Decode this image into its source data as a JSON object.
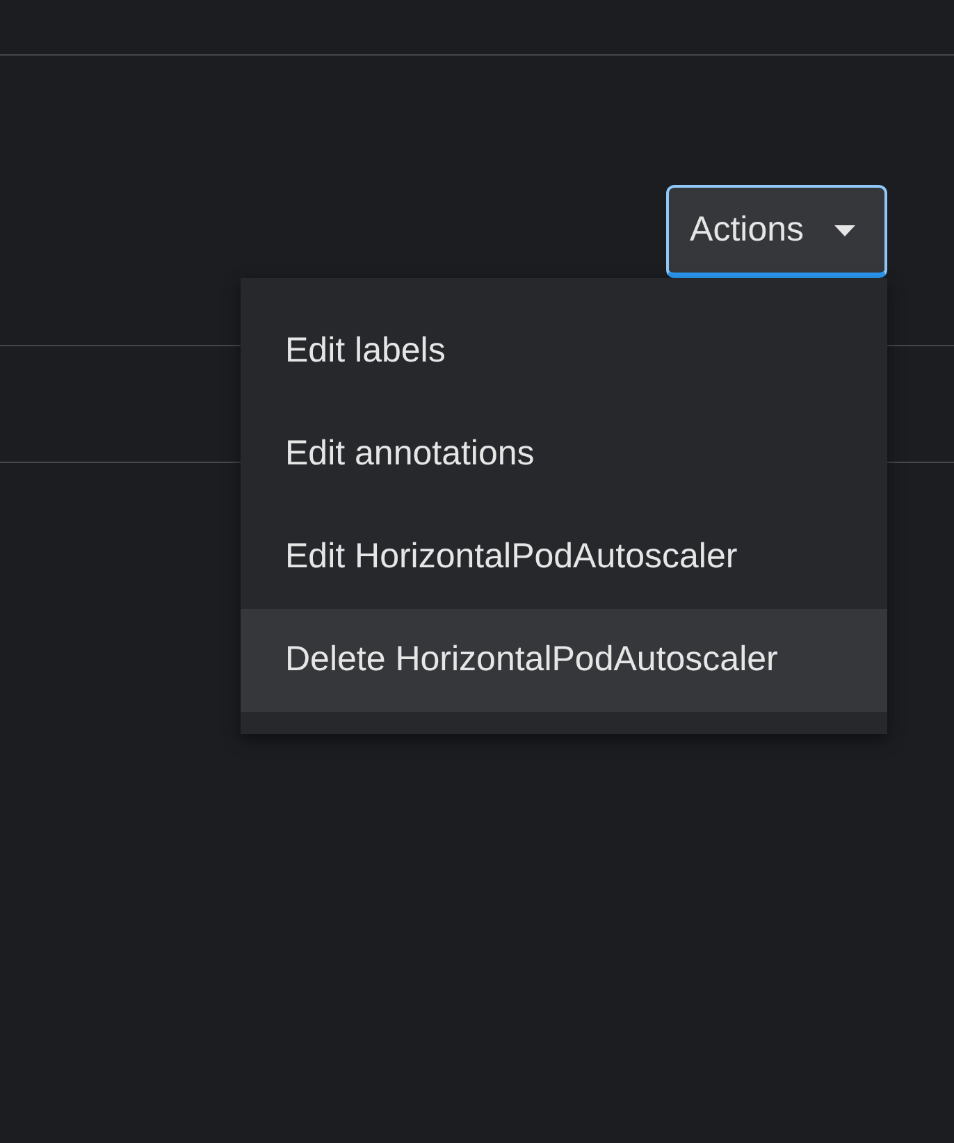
{
  "actions_button": {
    "label": "Actions",
    "expanded": true
  },
  "menu": {
    "items": [
      {
        "label": "Edit labels",
        "highlighted": false
      },
      {
        "label": "Edit annotations",
        "highlighted": false
      },
      {
        "label": "Edit HorizontalPodAutoscaler",
        "highlighted": false
      },
      {
        "label": "Delete HorizontalPodAutoscaler",
        "highlighted": true
      }
    ]
  }
}
